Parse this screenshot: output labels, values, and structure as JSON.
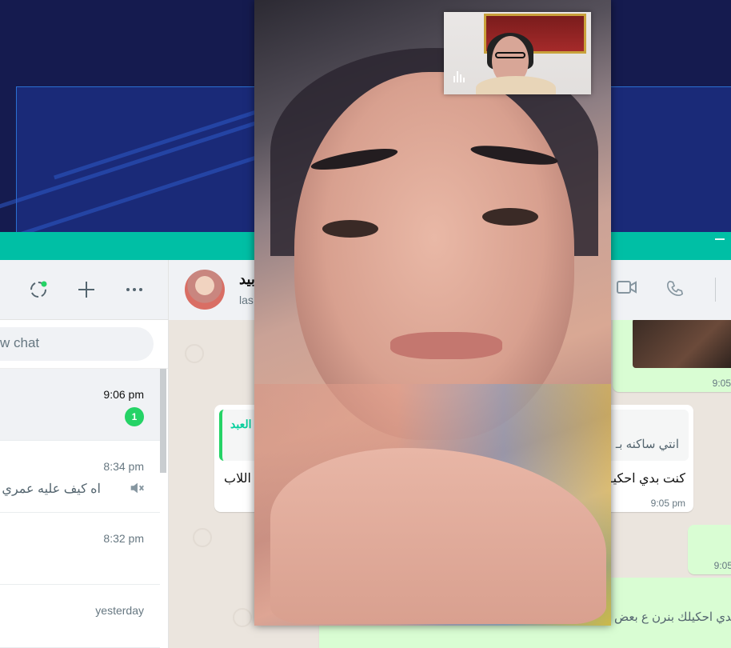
{
  "sidebar": {
    "search_placeholder": "w chat",
    "chats": [
      {
        "time": "9:06 pm",
        "unread": "1",
        "preview": ""
      },
      {
        "time": "8:34 pm",
        "preview": "اه كيف عليه عمري"
      },
      {
        "time": "8:32 pm",
        "preview": ""
      },
      {
        "time": "yesterday",
        "preview": ""
      }
    ]
  },
  "header": {
    "contact_name": "بيد",
    "contact_status": "las"
  },
  "messages": {
    "top_image_time": "9:05",
    "quoted_name": "العبد",
    "quoted_text": "انتي ساكنه بـ",
    "reply_text": "كنت بدي احكيـ",
    "reply_text_left": "اللاب",
    "reply_time": "9:05 pm",
    "out_small_time": "9:05",
    "bottom_text": "بدي احكيلك بنرن ع بعض"
  }
}
